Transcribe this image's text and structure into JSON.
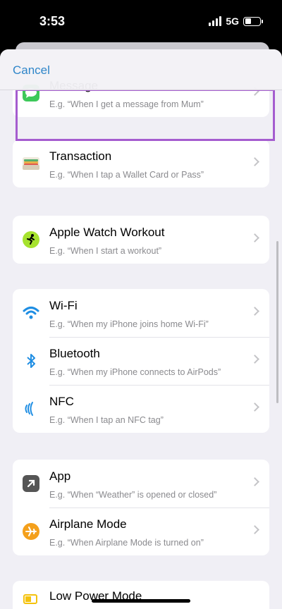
{
  "status_bar": {
    "time": "3:53",
    "network": "5G",
    "icons": [
      "signal-icon",
      "battery-icon"
    ]
  },
  "header": {
    "cancel_label": "Cancel"
  },
  "rows": {
    "message": {
      "title": "Message",
      "subtitle": "E.g. “When I get a message from Mum”",
      "icon": "message-icon"
    },
    "transaction": {
      "title": "Transaction",
      "subtitle": "E.g. “When I tap a Wallet Card or Pass”",
      "icon": "wallet-icon"
    },
    "workout": {
      "title": "Apple Watch Workout",
      "subtitle": "E.g. “When I start a workout”",
      "icon": "workout-icon"
    },
    "wifi": {
      "title": "Wi-Fi",
      "subtitle": "E.g. “When my iPhone joins home Wi-Fi”",
      "icon": "wifi-icon"
    },
    "bluetooth": {
      "title": "Bluetooth",
      "subtitle": "E.g. “When my iPhone connects to AirPods”",
      "icon": "bluetooth-icon"
    },
    "nfc": {
      "title": "NFC",
      "subtitle": "E.g. “When I tap an NFC tag”",
      "icon": "nfc-icon"
    },
    "app": {
      "title": "App",
      "subtitle": "E.g. “When “Weather” is opened or closed”",
      "icon": "app-icon"
    },
    "airplane": {
      "title": "Airplane Mode",
      "subtitle": "E.g. “When Airplane Mode is turned on”",
      "icon": "airplane-icon"
    },
    "low_power": {
      "title": "Low Power Mode",
      "icon": "battery-low-icon"
    }
  },
  "colors": {
    "accent": "#2f86c9",
    "highlight": "#a55ccf",
    "background": "#f0eff5"
  }
}
